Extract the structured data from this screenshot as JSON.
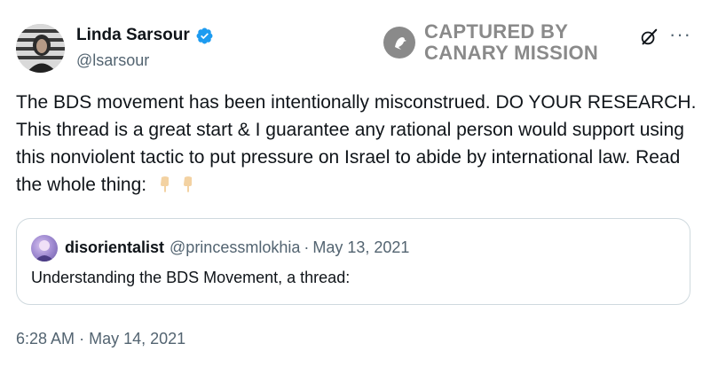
{
  "author": {
    "name": "Linda Sarsour",
    "handle": "@lsarsour",
    "verified": true
  },
  "watermark": {
    "line1": "CAPTURED BY",
    "line2": "CANARY MISSION"
  },
  "icons": {
    "verified": "verified-badge-icon",
    "grok": "grok-icon",
    "more": "more-options-icon",
    "emoji": "pointing-down-hand-emoji"
  },
  "tweet": {
    "text": "The BDS movement has been intentionally misconstrued. DO YOUR RESEARCH. This thread is a great start & I guarantee any rational person would support using this nonviolent tactic to put pressure on Israel to abide by international law. Read the whole thing:",
    "emoji_1": "👇",
    "emoji_2": "👇"
  },
  "quoted": {
    "name": "disorientalist",
    "handle": "@princessmlokhia",
    "separator": "·",
    "date": "May 13, 2021",
    "text": "Understanding the BDS Movement, a thread:"
  },
  "meta": {
    "time": "6:28 AM",
    "separator": "·",
    "date": "May 14, 2021"
  },
  "colors": {
    "verified": "#1d9bf0",
    "text": "#0f1419",
    "secondary": "#536471",
    "border": "#cfd9de",
    "watermark": "#8a8a8a",
    "emoji_skin": "#f3d2a2"
  }
}
